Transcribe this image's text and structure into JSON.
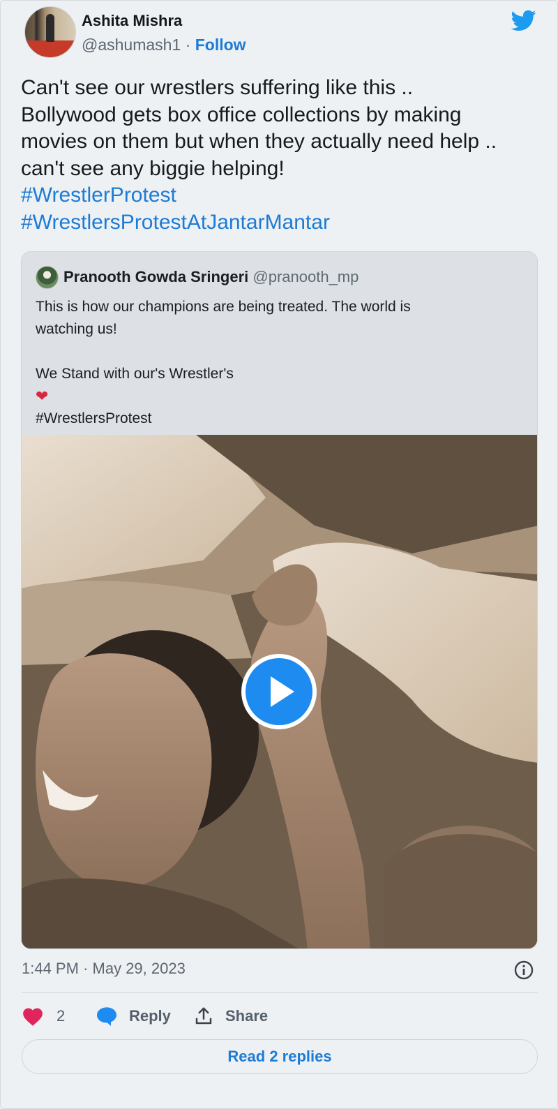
{
  "author": {
    "name": "Ashita Mishra",
    "handle": "@ashumash1",
    "separator": "·",
    "follow_label": "Follow"
  },
  "tweet": {
    "lines": [
      "Can't see our wrestlers suffering like this ..",
      "Bollywood gets box office collections by making",
      "movies on them but when they actually need help ..",
      "can't see any biggie helping!"
    ],
    "hashtags": [
      "#WrestlerProtest",
      "#WrestlersProtestAtJantarMantar"
    ]
  },
  "quote": {
    "name": "Pranooth Gowda Sringeri",
    "handle": "@pranooth_mp",
    "lines": [
      "This is how our champions are being treated. The world is",
      "watching us!"
    ],
    "line3": "We Stand with our's  Wrestler's",
    "heart": "❤",
    "hashtag": "#WrestlersProtest"
  },
  "meta": {
    "time": "1:44 PM",
    "separator": "·",
    "date": "May 29, 2023"
  },
  "actions": {
    "like_count": "2",
    "reply_label": "Reply",
    "share_label": "Share",
    "read_replies_label": "Read 2 replies"
  },
  "colors": {
    "accent": "#1d7bd4",
    "like": "#e0245e",
    "play": "#1d8bf0"
  },
  "icons": [
    "twitter-bird-icon",
    "play-icon",
    "info-icon",
    "heart-icon",
    "reply-bubble-icon",
    "share-icon"
  ]
}
